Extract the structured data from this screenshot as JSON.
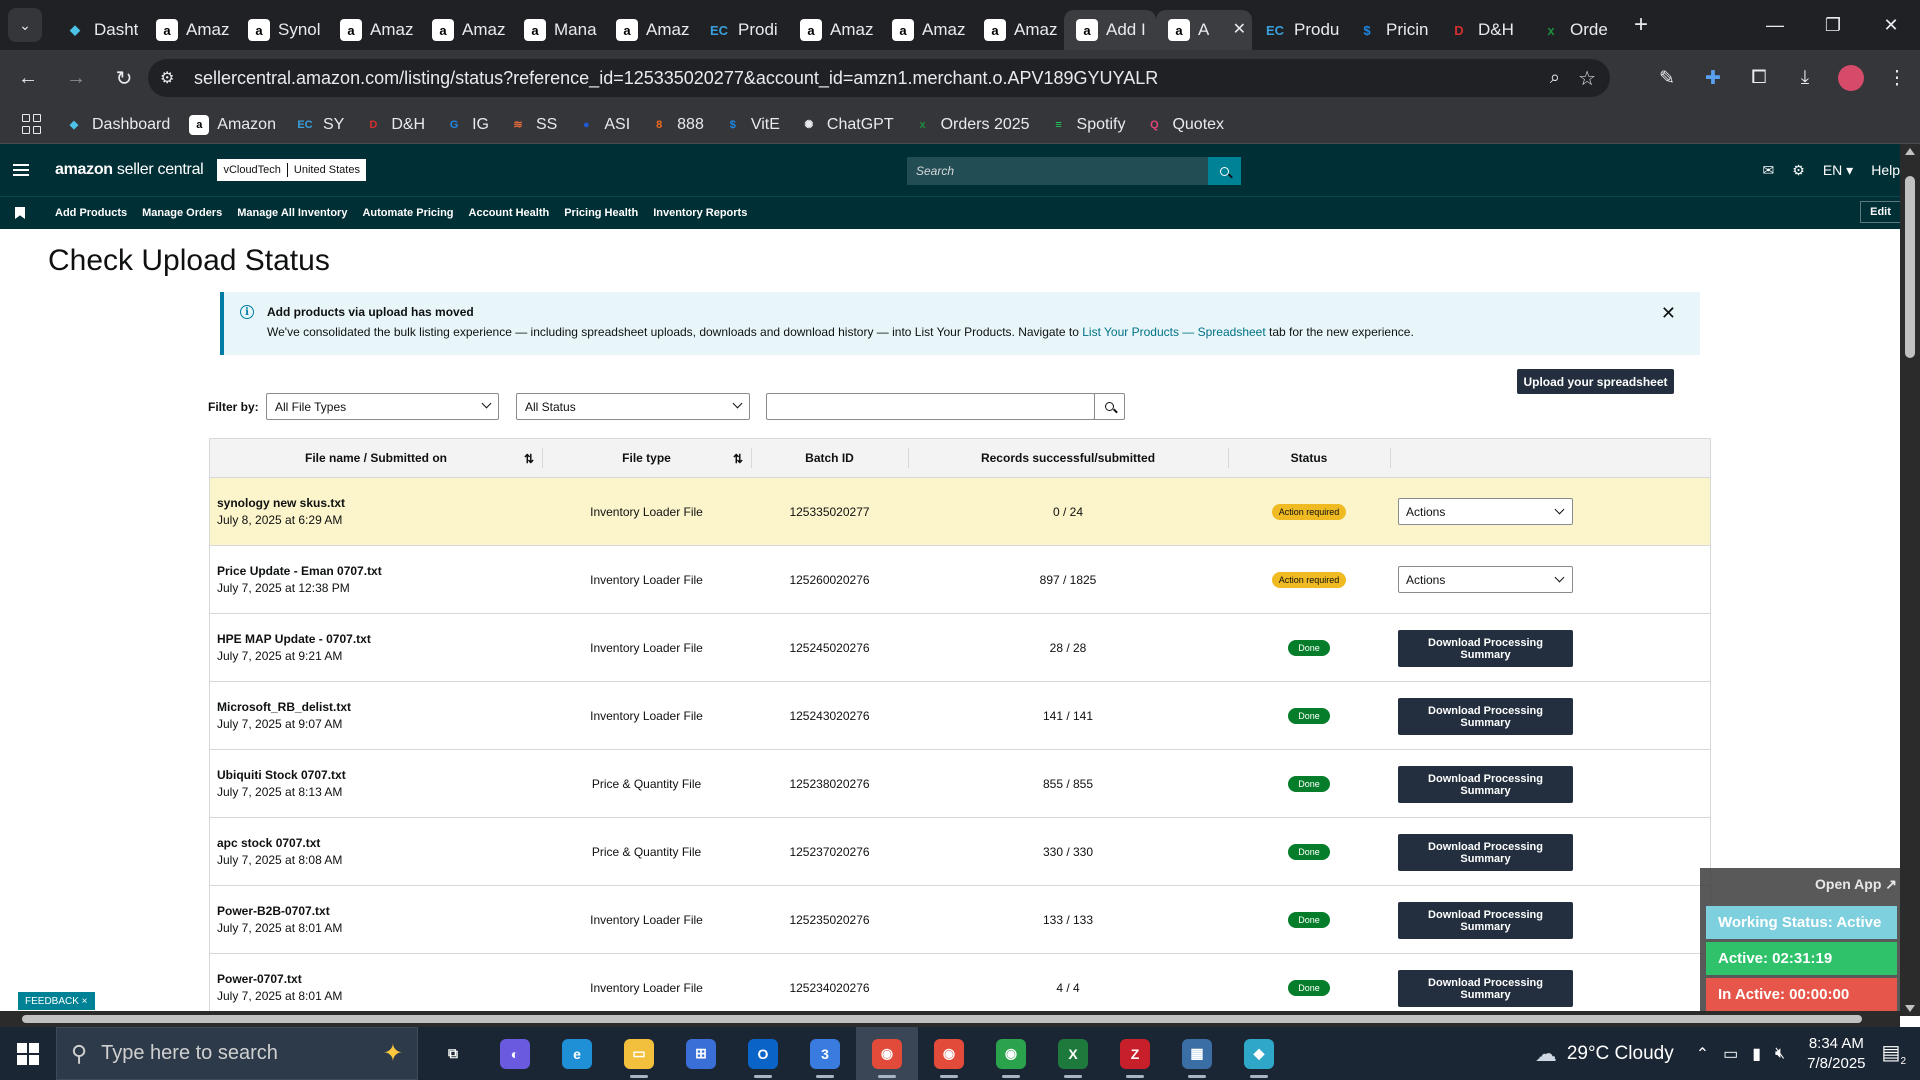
{
  "browser": {
    "tabs": [
      {
        "label": "Dasht",
        "icon": "dash-icon",
        "color": "#4dc2e8",
        "glyph": "◆"
      },
      {
        "label": "Amaz",
        "icon": "amazon-icon",
        "color": "#ffffff",
        "glyph": "a"
      },
      {
        "label": "Synol",
        "icon": "amazon-icon",
        "color": "#ffffff",
        "glyph": "a"
      },
      {
        "label": "Amaz",
        "icon": "amazon-icon",
        "color": "#ffffff",
        "glyph": "a"
      },
      {
        "label": "Amaz",
        "icon": "amazon-icon",
        "color": "#ffffff",
        "glyph": "a"
      },
      {
        "label": "Mana",
        "icon": "amazon-icon",
        "color": "#ffffff",
        "glyph": "a"
      },
      {
        "label": "Amaz",
        "icon": "amazon-icon",
        "color": "#ffffff",
        "glyph": "a"
      },
      {
        "label": "Prodi",
        "icon": "ec-icon",
        "color": "#3aa0dc",
        "glyph": "EC"
      },
      {
        "label": "Amaz",
        "icon": "amazon-icon",
        "color": "#ffffff",
        "glyph": "a"
      },
      {
        "label": "Amaz",
        "icon": "amazon-icon",
        "color": "#ffffff",
        "glyph": "a"
      },
      {
        "label": "Amaz",
        "icon": "amazon-icon",
        "color": "#ffffff",
        "glyph": "a"
      },
      {
        "label": "Add I",
        "icon": "amazon-icon",
        "color": "#ffffff",
        "glyph": "a"
      },
      {
        "label": "A",
        "icon": "amazon-icon",
        "color": "#ffffff",
        "glyph": "a"
      },
      {
        "label": "Produ",
        "icon": "ec-icon",
        "color": "#3aa0dc",
        "glyph": "EC"
      },
      {
        "label": "Pricin",
        "icon": "dollar-icon",
        "color": "#1e88e5",
        "glyph": "$"
      },
      {
        "label": "D&H",
        "icon": "dh-icon",
        "color": "#d32f2f",
        "glyph": "D"
      },
      {
        "label": "Orde",
        "icon": "sheets-icon",
        "color": "#1e8e3e",
        "glyph": "x"
      }
    ],
    "url": "sellercentral.amazon.com/listing/status?reference_id=125335020277&account_id=amzn1.merchant.o.APV189GYUYALR",
    "bookmarks": [
      {
        "label": "Dashboard",
        "icon": "dash-icon",
        "color": "#4dc2e8",
        "glyph": "◆"
      },
      {
        "label": "Amazon",
        "icon": "amazon-icon",
        "color": "#ffffff",
        "glyph": "a"
      },
      {
        "label": "SY",
        "icon": "ec-icon",
        "color": "#3aa0dc",
        "glyph": "EC"
      },
      {
        "label": "D&H",
        "icon": "dh-icon",
        "color": "#d32f2f",
        "glyph": "D"
      },
      {
        "label": "IG",
        "icon": "ig-icon",
        "color": "#1e88e5",
        "glyph": "G"
      },
      {
        "label": "SS",
        "icon": "ss-icon",
        "color": "#e86a3a",
        "glyph": "≋"
      },
      {
        "label": "ASI",
        "icon": "asi-icon",
        "color": "#1e5ad8",
        "glyph": "●"
      },
      {
        "label": "888",
        "icon": "888-icon",
        "color": "#f06a1e",
        "glyph": "8"
      },
      {
        "label": "VitE",
        "icon": "dollar-icon",
        "color": "#1e88e5",
        "glyph": "$"
      },
      {
        "label": "ChatGPT",
        "icon": "chatgpt-icon",
        "color": "#e8eaed",
        "glyph": "✺"
      },
      {
        "label": "Orders 2025",
        "icon": "sheets-icon",
        "color": "#1e8e3e",
        "glyph": "x"
      },
      {
        "label": "Spotify",
        "icon": "spotify-icon",
        "color": "#1ed760",
        "glyph": "≡"
      },
      {
        "label": "Quotex",
        "icon": "quotex-icon",
        "color": "#e0457b",
        "glyph": "Q"
      }
    ]
  },
  "header": {
    "logo_bold": "amazon",
    "logo_rest": " seller central",
    "store": "vCloudTech",
    "region": "United States",
    "search_placeholder": "Search",
    "lang": "EN ▾",
    "help": "Help"
  },
  "nav": {
    "items": [
      "Add Products",
      "Manage Orders",
      "Manage All Inventory",
      "Automate Pricing",
      "Account Health",
      "Pricing Health",
      "Inventory Reports"
    ],
    "edit": "Edit"
  },
  "page": {
    "title": "Check Upload Status",
    "banner": {
      "title": "Add products via upload has moved",
      "text": "We've consolidated the bulk listing experience — including spreadsheet uploads, downloads and download history — into List Your Products. Navigate to ",
      "link": "List Your Products — Spreadsheet",
      "text_after": " tab for the new experience."
    },
    "upload_button": "Upload your spreadsheet",
    "filter_label": "Filter by:",
    "file_type_filter": "All File Types",
    "status_filter": "All Status"
  },
  "table": {
    "headers": [
      "File name / Submitted on",
      "File type",
      "Batch ID",
      "Records successful/submitted",
      "Status"
    ],
    "rows": [
      {
        "name": "synology new skus.txt",
        "date": "July 8, 2025 at 6:29 AM",
        "type": "Inventory Loader File",
        "batch": "125335020277",
        "records": "0 / 24",
        "status": "Action required",
        "status_kind": "req",
        "action": "Actions",
        "highlight": true
      },
      {
        "name": "Price Update - Eman 0707.txt",
        "date": "July 7, 2025 at 12:38 PM",
        "type": "Inventory Loader File",
        "batch": "125260020276",
        "records": "897 / 1825",
        "status": "Action required",
        "status_kind": "req",
        "action": "Actions",
        "highlight": false
      },
      {
        "name": "HPE MAP Update - 0707.txt",
        "date": "July 7, 2025 at 9:21 AM",
        "type": "Inventory Loader File",
        "batch": "125245020276",
        "records": "28 / 28",
        "status": "Done",
        "status_kind": "done",
        "action": "Download Processing Summary",
        "highlight": false
      },
      {
        "name": "Microsoft_RB_delist.txt",
        "date": "July 7, 2025 at 9:07 AM",
        "type": "Inventory Loader File",
        "batch": "125243020276",
        "records": "141 / 141",
        "status": "Done",
        "status_kind": "done",
        "action": "Download Processing Summary",
        "highlight": false
      },
      {
        "name": "Ubiquiti Stock 0707.txt",
        "date": "July 7, 2025 at 8:13 AM",
        "type": "Price & Quantity File",
        "batch": "125238020276",
        "records": "855 / 855",
        "status": "Done",
        "status_kind": "done",
        "action": "Download Processing Summary",
        "highlight": false
      },
      {
        "name": "apc stock 0707.txt",
        "date": "July 7, 2025 at 8:08 AM",
        "type": "Price & Quantity File",
        "batch": "125237020276",
        "records": "330 / 330",
        "status": "Done",
        "status_kind": "done",
        "action": "Download Processing Summary",
        "highlight": false
      },
      {
        "name": "Power-B2B-0707.txt",
        "date": "July 7, 2025 at 8:01 AM",
        "type": "Inventory Loader File",
        "batch": "125235020276",
        "records": "133 / 133",
        "status": "Done",
        "status_kind": "done",
        "action": "Download Processing Summary",
        "highlight": false
      },
      {
        "name": "Power-0707.txt",
        "date": "July 7, 2025 at 8:01 AM",
        "type": "Inventory Loader File",
        "batch": "125234020276",
        "records": "4 / 4",
        "status": "Done",
        "status_kind": "done",
        "action": "Download Processing Summary",
        "highlight": false
      }
    ]
  },
  "feedback": "FEEDBACK ×",
  "widget": {
    "open_app": "Open App ↗",
    "working_status": "Working Status: Active",
    "active": "Active: 02:31:19",
    "inactive": "In Active: 00:00:00"
  },
  "taskbar": {
    "search_placeholder": "Type here to search",
    "weather": "29°C  Cloudy",
    "time": "8:34 AM",
    "date": "7/8/2025",
    "notif_count": "2",
    "apps": [
      {
        "name": "task-view-icon",
        "color": "#1b2634",
        "glyph": "⧉",
        "running": false
      },
      {
        "name": "copilot-icon",
        "color": "#6a5ae0",
        "glyph": "◐",
        "running": false
      },
      {
        "name": "edge-icon",
        "color": "#1f8fd6",
        "glyph": "e",
        "running": false
      },
      {
        "name": "file-explorer-icon",
        "color": "#f3c03d",
        "glyph": "▭",
        "running": true
      },
      {
        "name": "store-icon",
        "color": "#3b6fd8",
        "glyph": "⊞",
        "running": false
      },
      {
        "name": "outlook-icon",
        "color": "#0a64c8",
        "glyph": "O",
        "running": true
      },
      {
        "name": "chrome-profile-icon",
        "color": "#3a7be0",
        "glyph": "3",
        "running": true
      },
      {
        "name": "chrome-icon",
        "color": "#e24b3a",
        "glyph": "◉",
        "running": true
      },
      {
        "name": "chrome-icon",
        "color": "#e24b3a",
        "glyph": "◉",
        "running": true
      },
      {
        "name": "chrome-icon",
        "color": "#2ba24c",
        "glyph": "◉",
        "running": true
      },
      {
        "name": "excel-icon",
        "color": "#1e7a3c",
        "glyph": "X",
        "running": true
      },
      {
        "name": "filezilla-icon",
        "color": "#c8202a",
        "glyph": "Z",
        "running": true
      },
      {
        "name": "calculator-icon",
        "color": "#3a6ea5",
        "glyph": "▦",
        "running": true
      },
      {
        "name": "app-diamond-icon",
        "color": "#2fa7c8",
        "glyph": "◆",
        "running": true
      }
    ]
  }
}
